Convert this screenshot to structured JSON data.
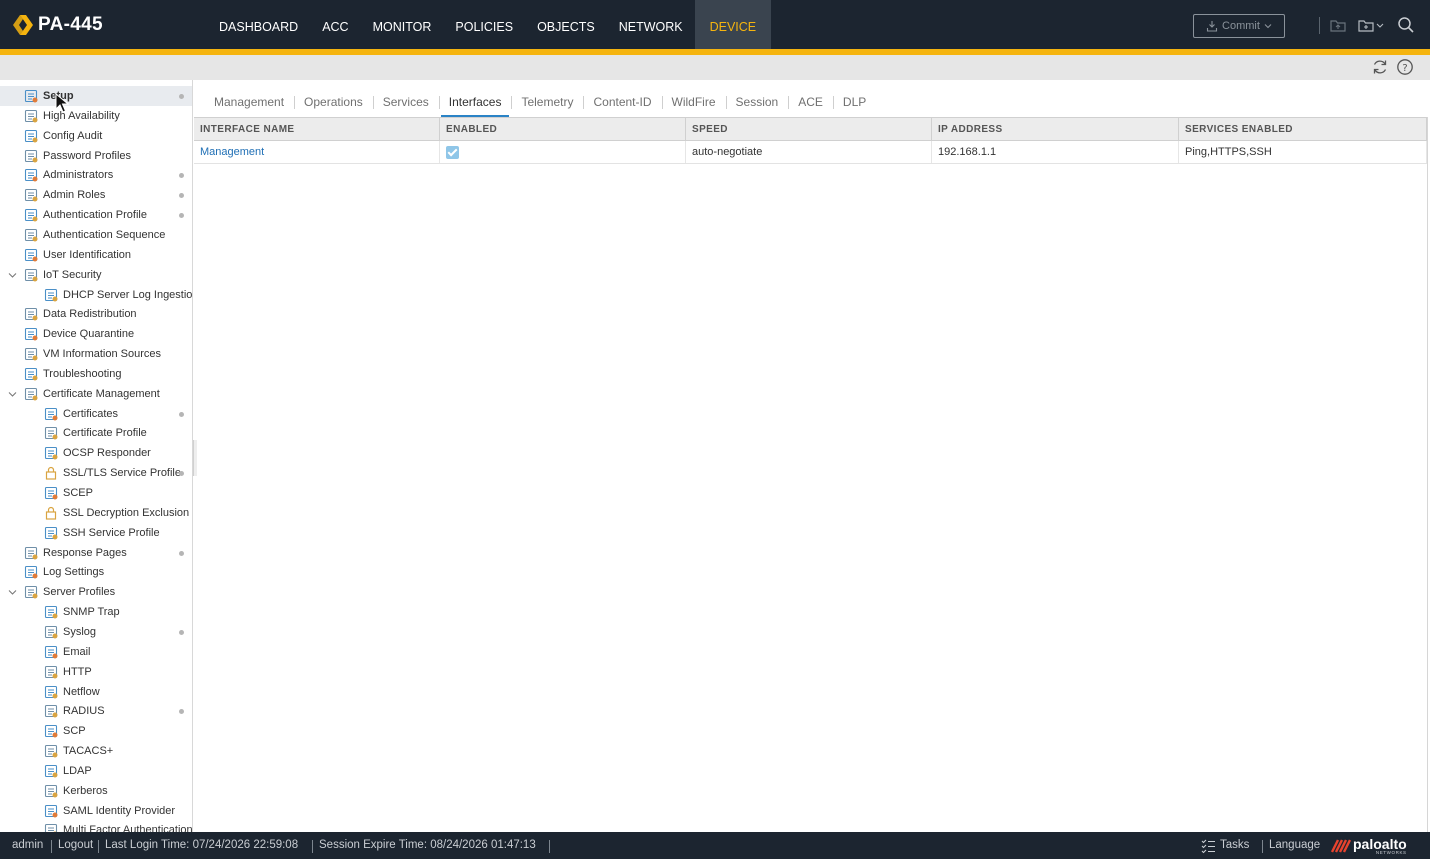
{
  "app": {
    "title": "PA-445"
  },
  "nav": {
    "items": [
      "DASHBOARD",
      "ACC",
      "MONITOR",
      "POLICIES",
      "OBJECTS",
      "NETWORK",
      "DEVICE"
    ],
    "active": "DEVICE"
  },
  "header": {
    "commit_label": "Commit",
    "accent_color": "#f5b40f",
    "bar_color": "#1c2530"
  },
  "sidebar": {
    "items": [
      {
        "label": "Setup",
        "icon": "setup-icon",
        "dot": true,
        "selected": true
      },
      {
        "label": "High Availability",
        "icon": "high-availability-icon",
        "dot": false
      },
      {
        "label": "Config Audit",
        "icon": "config-audit-icon",
        "dot": false
      },
      {
        "label": "Password Profiles",
        "icon": "password-profiles-icon",
        "dot": false
      },
      {
        "label": "Administrators",
        "icon": "administrators-icon",
        "dot": true
      },
      {
        "label": "Admin Roles",
        "icon": "admin-roles-icon",
        "dot": true
      },
      {
        "label": "Authentication Profile",
        "icon": "authentication-profile-icon",
        "dot": true
      },
      {
        "label": "Authentication Sequence",
        "icon": "authentication-sequence-icon",
        "dot": false
      },
      {
        "label": "User Identification",
        "icon": "user-identification-icon",
        "dot": false
      },
      {
        "label": "IoT Security",
        "icon": "iot-security-icon",
        "dot": false,
        "expanded": true
      },
      {
        "label": "DHCP Server Log Ingestion",
        "icon": "dhcp-server-log-icon",
        "dot": false,
        "indent": 1
      },
      {
        "label": "Data Redistribution",
        "icon": "data-redistribution-icon",
        "dot": false
      },
      {
        "label": "Device Quarantine",
        "icon": "device-quarantine-icon",
        "dot": false
      },
      {
        "label": "VM Information Sources",
        "icon": "vm-information-sources-icon",
        "dot": false
      },
      {
        "label": "Troubleshooting",
        "icon": "troubleshooting-icon",
        "dot": false
      },
      {
        "label": "Certificate Management",
        "icon": "certificate-management-icon",
        "dot": false,
        "expanded": true
      },
      {
        "label": "Certificates",
        "icon": "certificates-icon",
        "dot": true,
        "indent": 1
      },
      {
        "label": "Certificate Profile",
        "icon": "certificate-profile-icon",
        "dot": false,
        "indent": 1
      },
      {
        "label": "OCSP Responder",
        "icon": "ocsp-responder-icon",
        "dot": false,
        "indent": 1
      },
      {
        "label": "SSL/TLS Service Profile",
        "icon": "ssl-tls-lock-icon",
        "dot": true,
        "indent": 1
      },
      {
        "label": "SCEP",
        "icon": "scep-icon",
        "dot": false,
        "indent": 1
      },
      {
        "label": "SSL Decryption Exclusion",
        "icon": "ssl-decryption-lock-icon",
        "dot": false,
        "indent": 1
      },
      {
        "label": "SSH Service Profile",
        "icon": "ssh-service-profile-icon",
        "dot": false,
        "indent": 1
      },
      {
        "label": "Response Pages",
        "icon": "response-pages-icon",
        "dot": true
      },
      {
        "label": "Log Settings",
        "icon": "log-settings-icon",
        "dot": false
      },
      {
        "label": "Server Profiles",
        "icon": "server-profiles-icon",
        "dot": false,
        "expanded": true
      },
      {
        "label": "SNMP Trap",
        "icon": "snmp-trap-icon",
        "dot": false,
        "indent": 1
      },
      {
        "label": "Syslog",
        "icon": "syslog-icon",
        "dot": true,
        "indent": 1
      },
      {
        "label": "Email",
        "icon": "email-icon",
        "dot": false,
        "indent": 1
      },
      {
        "label": "HTTP",
        "icon": "http-icon",
        "dot": false,
        "indent": 1
      },
      {
        "label": "Netflow",
        "icon": "netflow-icon",
        "dot": false,
        "indent": 1
      },
      {
        "label": "RADIUS",
        "icon": "radius-icon",
        "dot": true,
        "indent": 1
      },
      {
        "label": "SCP",
        "icon": "scp-icon",
        "dot": false,
        "indent": 1
      },
      {
        "label": "TACACS+",
        "icon": "tacacs-icon",
        "dot": false,
        "indent": 1
      },
      {
        "label": "LDAP",
        "icon": "ldap-icon",
        "dot": false,
        "indent": 1
      },
      {
        "label": "Kerberos",
        "icon": "kerberos-icon",
        "dot": false,
        "indent": 1
      },
      {
        "label": "SAML Identity Provider",
        "icon": "saml-identity-provider-icon",
        "dot": false,
        "indent": 1
      },
      {
        "label": "Multi Factor Authentication",
        "icon": "multi-factor-authentication-icon",
        "dot": false,
        "indent": 1
      }
    ]
  },
  "tabs": {
    "items": [
      "Management",
      "Operations",
      "Services",
      "Interfaces",
      "Telemetry",
      "Content-ID",
      "WildFire",
      "Session",
      "ACE",
      "DLP"
    ],
    "active": "Interfaces"
  },
  "table": {
    "columns": [
      "INTERFACE NAME",
      "ENABLED",
      "SPEED",
      "IP ADDRESS",
      "SERVICES ENABLED"
    ],
    "rows": [
      {
        "interface_name": "Management",
        "enabled": true,
        "speed": "auto-negotiate",
        "ip_address": "192.168.1.1",
        "services_enabled": "Ping,HTTPS,SSH"
      }
    ]
  },
  "footer": {
    "user": "admin",
    "logout": "Logout",
    "last_login": "Last Login Time: 07/24/2026 22:59:08",
    "session_expire": "Session Expire Time: 08/24/2026 01:47:13",
    "tasks": "Tasks",
    "language": "Language",
    "brand": "paloalto",
    "brand_sub": "NETWORKS"
  }
}
